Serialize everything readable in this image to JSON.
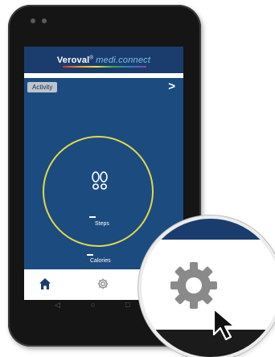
{
  "app": {
    "brand_main": "Veroval",
    "brand_reg": "®",
    "brand_accent": " medi.connect"
  },
  "activity": {
    "tab_label": "Activity",
    "next_label": ">",
    "steps_label": "Steps",
    "calories_label": "Calories"
  },
  "nav": {
    "items": [
      "home-icon",
      "settings-gear-icon"
    ]
  },
  "system_keys": {
    "back": "◁",
    "home": "○",
    "recents": "□"
  },
  "colors": {
    "header": "#1a3d6e",
    "panel": "#1c4b80",
    "ring": "#e2d84a",
    "nav_active": "#1a3d6e",
    "gear": "#8a8a8a"
  }
}
